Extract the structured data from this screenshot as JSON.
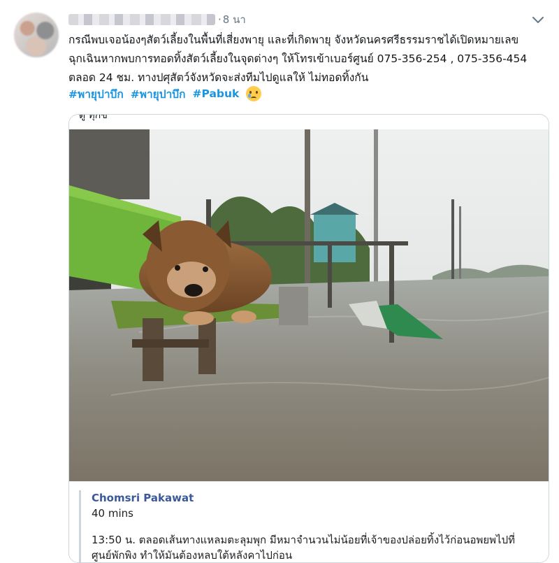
{
  "tweet": {
    "time": "8 นา",
    "dot": "·",
    "text": "กรณีพบเจอน้องๆสัตว์เลี้ยงในพื้นที่เสี่ยงพายุ และที่เกิดพายุ จังหวัดนครศรีธรรมราชได้เปิดหมายเลขฉุกเฉินหากพบการทอดทิ้งสัตว์เลี้ยงในจุดต่างๆ ให้โทรเข้าเบอร์ศูนย์ 075-356-254 , 075-356-454 ตลอด 24 ชม. ทางปศุสัตว์จังหวัดจะส่งทีมไปดูแลให้ ไม่ทอดทิ้งกัน",
    "hashtags": [
      "#พายุปาบึก",
      "#พายุปาบึก",
      "#Pabuk"
    ],
    "emoji": "crying-face-emoji"
  },
  "card": {
    "cut_text": "ดู ทุกข์",
    "author": "Chomsri Pakawat",
    "ago": "40 mins",
    "text": "13:50 น. ตลอดเส้นทางแหลมตะลุมพุก มีหมาจำนวนไม่น้อยที่เจ้าของปล่อยทิ้งไว้ก่อนอพยพไปที่ศูนย์พักพิง ทำให้มันต้องหลบใต้หลังคาไปก่อน"
  },
  "icons": {
    "menu": "chevron-down-icon"
  }
}
